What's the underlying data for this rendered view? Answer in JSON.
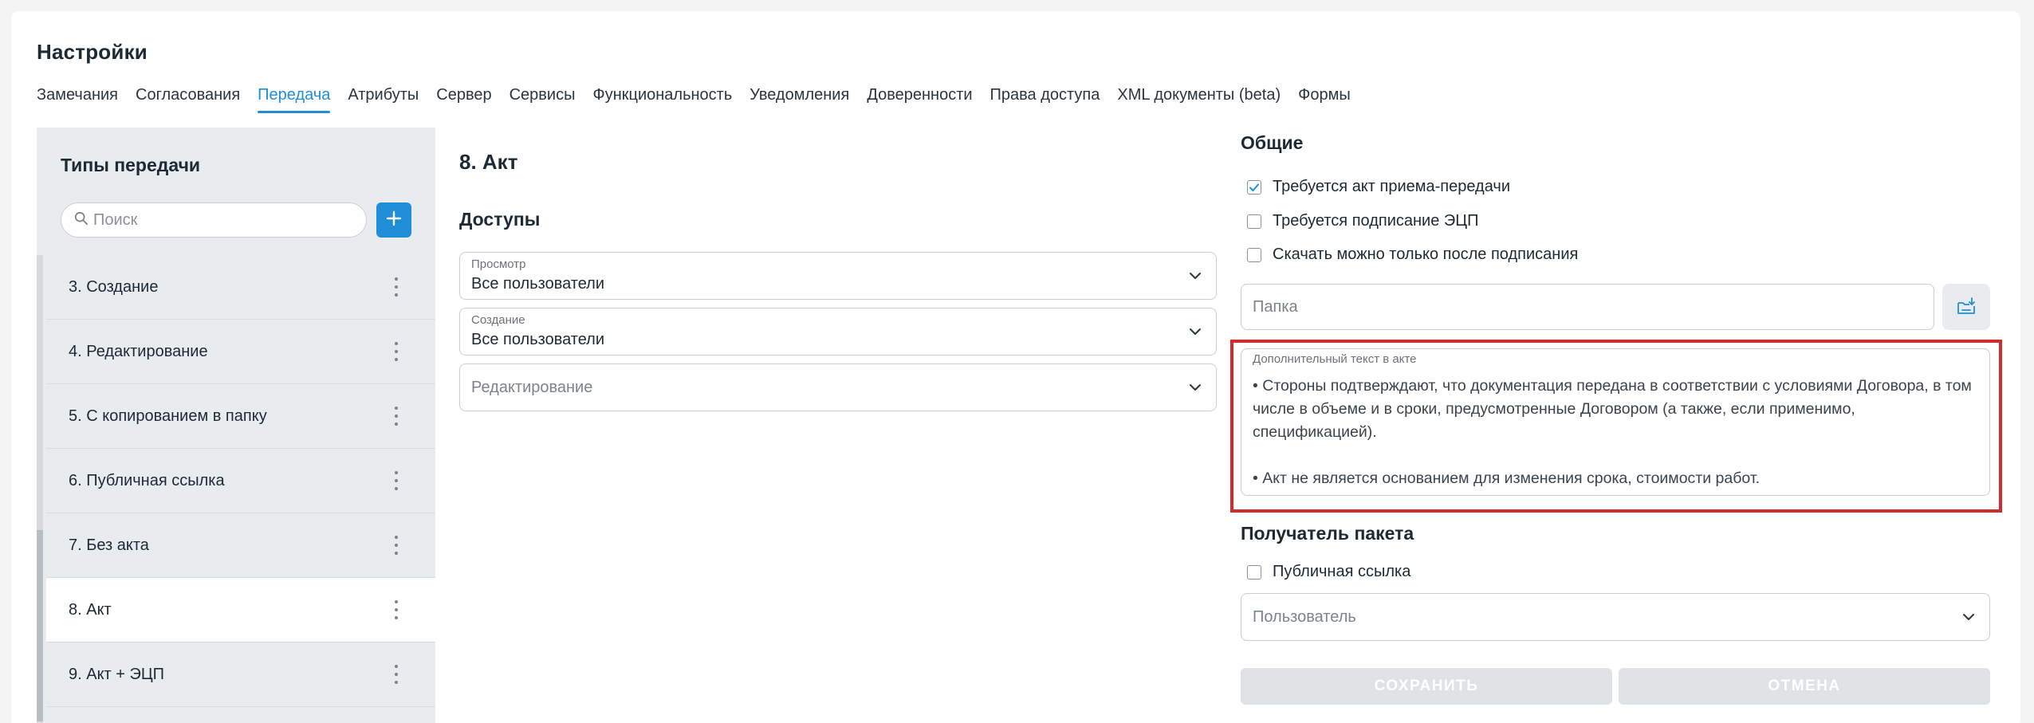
{
  "page": {
    "title": "Настройки"
  },
  "tabs": [
    {
      "label": "Замечания"
    },
    {
      "label": "Согласования"
    },
    {
      "label": "Передача"
    },
    {
      "label": "Атрибуты"
    },
    {
      "label": "Сервер"
    },
    {
      "label": "Сервисы"
    },
    {
      "label": "Функциональность"
    },
    {
      "label": "Уведомления"
    },
    {
      "label": "Доверенности"
    },
    {
      "label": "Права доступа"
    },
    {
      "label": "XML документы (beta)"
    },
    {
      "label": "Формы"
    }
  ],
  "active_tab": "Передача",
  "sidebar": {
    "title": "Типы передачи",
    "search_placeholder": "Поиск",
    "add_icon": "plus-icon",
    "items": [
      {
        "label": "3. Создание"
      },
      {
        "label": "4. Редактирование"
      },
      {
        "label": "5. С копированием в папку"
      },
      {
        "label": "6. Публичная ссылка"
      },
      {
        "label": "7. Без акта"
      },
      {
        "label": "8. Акт"
      },
      {
        "label": "9. Акт + ЭЦП"
      }
    ],
    "selected": "8. Акт"
  },
  "details": {
    "title": "8. Акт",
    "access_title": "Доступы",
    "view": {
      "label": "Просмотр",
      "value": "Все пользователи"
    },
    "create": {
      "label": "Создание",
      "value": "Все пользователи"
    },
    "edit": {
      "placeholder": "Редактирование"
    }
  },
  "general": {
    "title": "Общие",
    "options": [
      {
        "label": "Требуется акт приема-передачи",
        "checked": true
      },
      {
        "label": "Требуется подписание ЭЦП",
        "checked": false
      },
      {
        "label": "Скачать можно только после подписания",
        "checked": false
      }
    ],
    "folder_placeholder": "Папка",
    "folder_icon": "folder-download-icon",
    "extra_text": {
      "label": "Дополнительный текст в акте",
      "value": "• Стороны подтверждают, что документация передана в соответствии с условиями Договора, в том числе в объеме и в сроки, предусмотренные Договором (а также, если применимо, спецификацией).\n\n• Акт не является основанием для изменения срока, стоимости работ."
    }
  },
  "recipient": {
    "title": "Получатель пакета",
    "public_link": {
      "label": "Публичная ссылка",
      "checked": false
    },
    "user_placeholder": "Пользователь"
  },
  "actions": {
    "save_label": "СОХРАНИТЬ",
    "cancel_label": "ОТМЕНА"
  },
  "colors": {
    "accent": "#1f8ed6",
    "highlight": "#d22b2b",
    "disabled_button": "#e0e3e6"
  }
}
